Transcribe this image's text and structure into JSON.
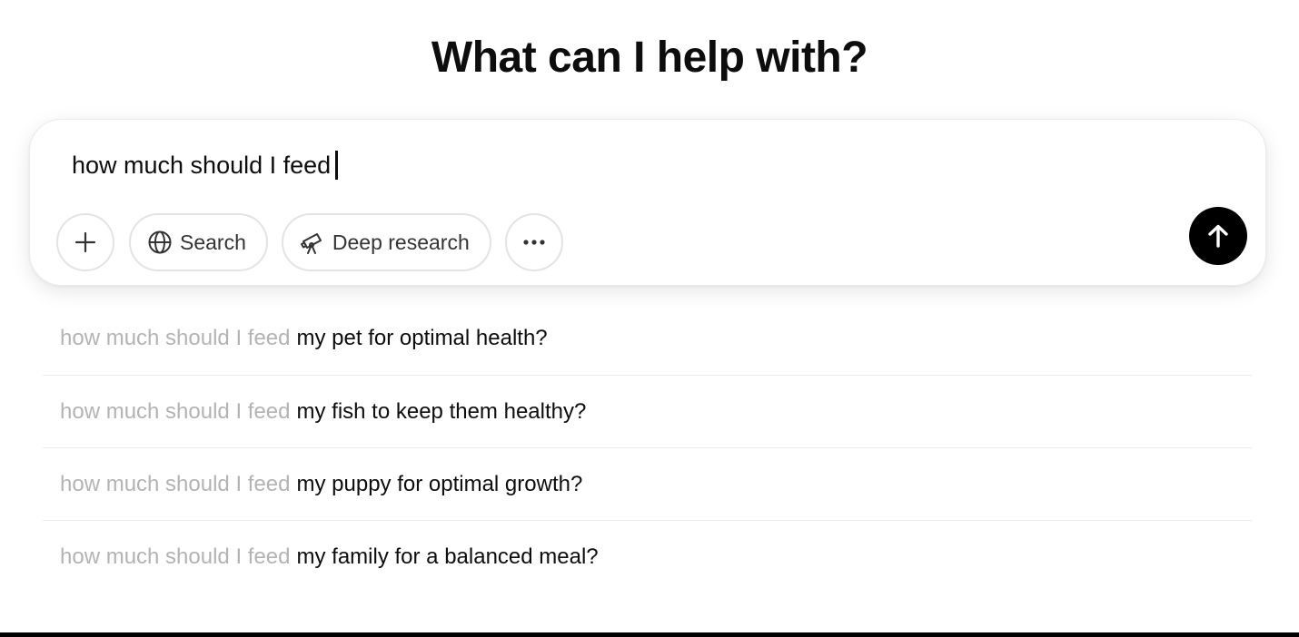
{
  "heading": "What can I help with?",
  "composer": {
    "input_value": "how much should I feed",
    "buttons": {
      "attach_icon": "plus-icon",
      "search_label": "Search",
      "search_icon": "globe-icon",
      "deep_research_label": "Deep research",
      "deep_research_icon": "telescope-icon",
      "more_icon": "more-dots-icon",
      "send_icon": "arrow-up-icon"
    }
  },
  "suggestions": [
    {
      "prefix": "how much should I feed",
      "completion": "my pet for optimal health?"
    },
    {
      "prefix": "how much should I feed",
      "completion": "my fish to keep them healthy?"
    },
    {
      "prefix": "how much should I feed",
      "completion": "my puppy for optimal growth?"
    },
    {
      "prefix": "how much should I feed",
      "completion": "my family for a balanced meal?"
    }
  ],
  "colors": {
    "text": "#0d0d0d",
    "muted_prefix": "#b3b3b3",
    "send_button": "#000000",
    "border": "#e3e3e3"
  }
}
